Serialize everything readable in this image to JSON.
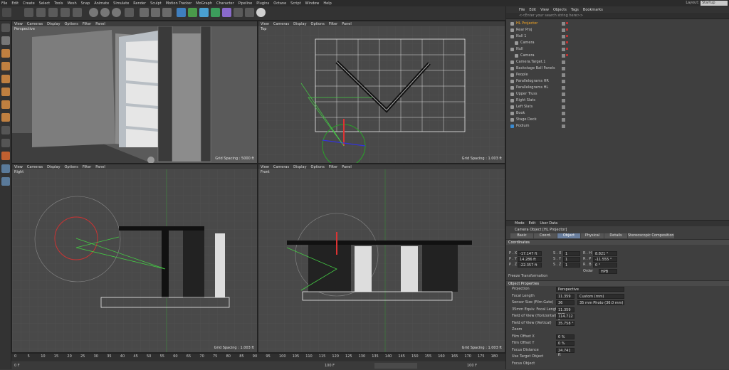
{
  "menu": [
    "File",
    "Edit",
    "Create",
    "Select",
    "Tools",
    "Mesh",
    "Snap",
    "Animate",
    "Simulate",
    "Render",
    "Sculpt",
    "Motion Tracker",
    "MoGraph",
    "Character",
    "Pipeline",
    "Plugins",
    "Octane",
    "Script",
    "Window",
    "Help"
  ],
  "layout": {
    "label": "Layout:",
    "value": "Startup"
  },
  "viewport_menu": [
    "View",
    "Cameras",
    "Display",
    "Options",
    "Filter",
    "Panel"
  ],
  "viewports": {
    "perspective": {
      "name": "Perspective",
      "grid": "Grid Spacing : 5000 ft"
    },
    "top": {
      "name": "Top",
      "grid": "Grid Spacing : 1.003 ft"
    },
    "right": {
      "name": "Right",
      "grid": "Grid Spacing : 1.003 ft"
    },
    "front": {
      "name": "Front",
      "grid": "Grid Spacing : 1.003 ft"
    }
  },
  "object_manager": {
    "menu": [
      "File",
      "Edit",
      "View",
      "Objects",
      "Tags",
      "Bookmarks"
    ],
    "search": "<<Enter your search string here>>",
    "objects": [
      {
        "name": "HL Projector",
        "level": 0,
        "selected": true
      },
      {
        "name": "Rear Proj",
        "level": 0
      },
      {
        "name": "Null 1",
        "level": 0
      },
      {
        "name": "Camera",
        "level": 1
      },
      {
        "name": "Null",
        "level": 0
      },
      {
        "name": "Camera",
        "level": 1
      },
      {
        "name": "Camera.Target.1",
        "level": 0
      },
      {
        "name": "Backstage Ball Panels",
        "level": 0
      },
      {
        "name": "People",
        "level": 0
      },
      {
        "name": "Parallelograms HR",
        "level": 0
      },
      {
        "name": "Parallelograms HL",
        "level": 0
      },
      {
        "name": "Upper Truss",
        "level": 0
      },
      {
        "name": "Right Slats",
        "level": 0
      },
      {
        "name": "Left Slats",
        "level": 0
      },
      {
        "name": "Book",
        "level": 0
      },
      {
        "name": "Stage Deck",
        "level": 0
      },
      {
        "name": "Podium",
        "level": 0
      }
    ]
  },
  "attributes": {
    "menu": [
      "Mode",
      "Edit",
      "User Data"
    ],
    "title": "Camera Object [HL Projector]",
    "tabs": [
      "Basic",
      "Coord.",
      "Object",
      "Physical",
      "Details",
      "Stereoscopic",
      "Composition"
    ],
    "active_tab": "Object",
    "coordinates": {
      "section": "Coordinates",
      "rows": [
        {
          "p_label": "P . X",
          "p_value": "-17.147 ft",
          "s_label": "S . X",
          "s_value": "1",
          "r_label": "R . H",
          "r_value": "8.821 °"
        },
        {
          "p_label": "P . Y",
          "p_value": "14.286 ft",
          "s_label": "S . Y",
          "s_value": "1",
          "r_label": "R . P",
          "r_value": "-11.555 °"
        },
        {
          "p_label": "P . Z",
          "p_value": "-22.357 ft",
          "s_label": "S . Z",
          "s_value": "1",
          "r_label": "R . B",
          "r_value": "0 °"
        }
      ],
      "order_label": "Order",
      "order_value": "HPB"
    },
    "freeze": "Freeze Transformation",
    "object_properties": {
      "section": "Object Properties",
      "rows": [
        {
          "label": "Projection",
          "value": "Perspective"
        },
        {
          "label": "Focal Length",
          "value": "11.359",
          "extra": "Custom (mm)"
        },
        {
          "label": "Sensor Size (Film Gate)",
          "value": "36",
          "extra": "35 mm Photo (36.0 mm)"
        },
        {
          "label": "35mm Equiv. Focal Length:",
          "value": "11.359 mm"
        },
        {
          "label": "Field of View (Horizontal)",
          "value": "114.712 °"
        },
        {
          "label": "Field of View (Vertical)",
          "value": "35.758 °"
        },
        {
          "label": "Zoom",
          "value": ""
        },
        {
          "label": "Film Offset X",
          "value": "0 %"
        },
        {
          "label": "Film Offset Y",
          "value": "0 %"
        },
        {
          "label": "Focus Distance",
          "value": "24.741 ft"
        },
        {
          "label": "Use Target Object",
          "value": ""
        },
        {
          "label": "Focus Object",
          "value": ""
        }
      ]
    }
  },
  "timeline": {
    "ticks": [
      "0",
      "5",
      "10",
      "15",
      "20",
      "25",
      "30",
      "35",
      "40",
      "45",
      "50",
      "55",
      "60",
      "65",
      "70",
      "75",
      "80",
      "85",
      "90",
      "95",
      "100",
      "105",
      "110",
      "115",
      "120",
      "125",
      "130",
      "135",
      "140",
      "145",
      "150",
      "155",
      "160",
      "165",
      "170",
      "175",
      "180"
    ],
    "start": "0 F",
    "end": "100 F",
    "current": "100 F"
  }
}
